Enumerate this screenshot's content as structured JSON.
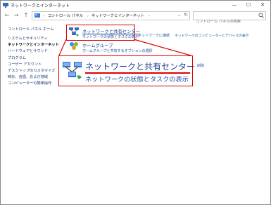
{
  "window": {
    "title": "ネットワークとインターネット",
    "controls": {
      "minimize": "—",
      "maximize": "☐",
      "close": "✕"
    }
  },
  "address_bar": {
    "back": "←",
    "forward": "→",
    "up": "↑",
    "breadcrumbs": [
      "コントロール パネル",
      "ネットワークとインターネット"
    ],
    "search_placeholder": "コントロール パネルの検索"
  },
  "sidebar": {
    "items": [
      {
        "label": "コントロール パネル ホーム"
      },
      {
        "label": "システムとセキュリティ"
      },
      {
        "label": "ネットワークとインターネット",
        "current": true
      },
      {
        "label": "ハードウェアとサウンド"
      },
      {
        "label": "プログラム"
      },
      {
        "label": "ユーザー アカウント"
      },
      {
        "label": "デスクトップのカスタマイズ"
      },
      {
        "label": "時計、言語、および地域"
      },
      {
        "label": "コンピューターの簡単操作"
      }
    ]
  },
  "main": {
    "network_center": {
      "title": "ネットワークと共有センター",
      "subtitle": "ネットワークの状態とタスクの表示",
      "links": [
        "ネットワークに接続",
        "ネットワークのコンピューターとデバイスの表示"
      ]
    },
    "homegroup": {
      "title": "ホームグループ",
      "subtitle": "ホームグループと共有するオプションの選択"
    },
    "partial_link": "削除"
  },
  "callout": {
    "title": "ネットワークと共有センター",
    "subtitle": "ネットワークの状態とタスクの表示"
  },
  "colors": {
    "highlight": "#e00000",
    "link": "#1f4fa0"
  }
}
